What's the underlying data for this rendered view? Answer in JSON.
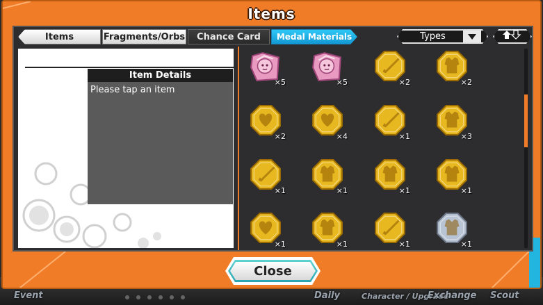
{
  "window": {
    "title": "Items"
  },
  "tabs": [
    {
      "label": "Items",
      "active": false
    },
    {
      "label": "Fragments/Orbs",
      "active": false
    },
    {
      "label": "Chance Card",
      "active": false
    },
    {
      "label": "Medal Materials",
      "active": true
    }
  ],
  "sort": {
    "label": "Types",
    "arrow_icon": "triangle-down-icon",
    "order_icon": "sort-order-up-down-icon"
  },
  "details": {
    "header": "Item Details",
    "placeholder": "Please tap an item"
  },
  "items": [
    {
      "icon": "pink-character-medal-icon",
      "qty": "×5"
    },
    {
      "icon": "pink-character-medal-icon",
      "qty": "×5"
    },
    {
      "icon": "gold-sword-medal-icon",
      "qty": "×2"
    },
    {
      "icon": "gold-armor-medal-icon",
      "qty": "×2"
    },
    {
      "icon": "gold-heart-medal-icon",
      "qty": "×2"
    },
    {
      "icon": "gold-heart-medal-icon",
      "qty": "×4"
    },
    {
      "icon": "gold-sword-medal-icon",
      "qty": "×1"
    },
    {
      "icon": "gold-armor-medal-icon",
      "qty": "×3"
    },
    {
      "icon": "gold-sword-medal-icon",
      "qty": "×1"
    },
    {
      "icon": "gold-armor-medal-icon",
      "qty": "×1"
    },
    {
      "icon": "gold-armor-medal-icon",
      "qty": "×1"
    },
    {
      "icon": "gold-armor-medal-icon",
      "qty": "×1"
    },
    {
      "icon": "gold-heart-medal-icon",
      "qty": "×1"
    },
    {
      "icon": "gold-armor-medal-icon",
      "qty": "×1"
    },
    {
      "icon": "gold-sword-medal-icon",
      "qty": "×1"
    },
    {
      "icon": "silver-armor-medal-icon",
      "qty": "×1"
    }
  ],
  "close_button": {
    "label": "Close"
  },
  "background_nav": [
    "Event",
    "Daily",
    "Character / Upgrade",
    "Exchange",
    "Scout"
  ],
  "colors": {
    "accent": "#f07c28",
    "active_tab": "#1fb0e8",
    "gold": "#e8b820",
    "silver": "#b8c4d4",
    "pink": "#e89ac0"
  }
}
